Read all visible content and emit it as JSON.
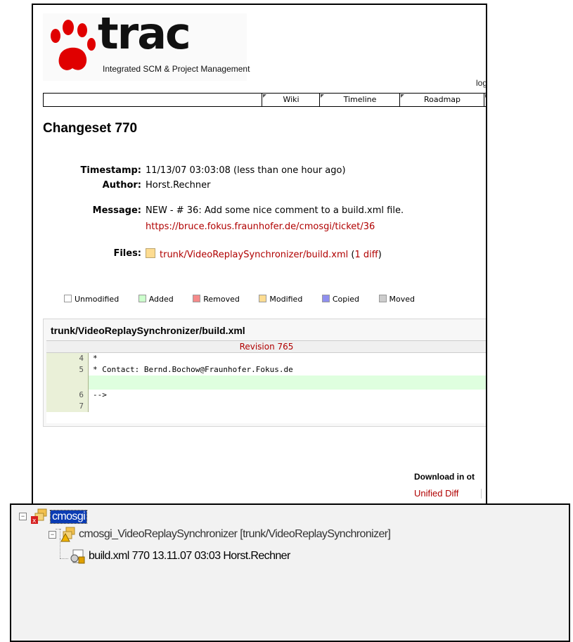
{
  "trac": {
    "logo_word": "trac",
    "logo_tagline": "Integrated SCM & Project Management",
    "login_fragment": "log",
    "nav": [
      "Wiki",
      "Timeline",
      "Roadmap"
    ],
    "page_title": "Changeset 770",
    "props": {
      "timestamp_label": "Timestamp:",
      "timestamp_value": "11/13/07 03:03:08 (less than one hour ago)",
      "author_label": "Author:",
      "author_value": "Horst.Rechner",
      "message_label": "Message:",
      "message_value": "NEW - # 36: Add some nice comment to a build.xml file.",
      "message_link": "https://bruce.fokus.fraunhofer.de/cmosgi/ticket/36",
      "files_label": "Files:",
      "file_path": "trunk/VideoReplaySynchronizer/build.xml",
      "diff_open": "(",
      "diff_link": "1 diff",
      "diff_close": ")"
    },
    "legend": [
      {
        "label": "Unmodified",
        "color": "#ffffff"
      },
      {
        "label": "Added",
        "color": "#ccffcc"
      },
      {
        "label": "Removed",
        "color": "#f58a8a"
      },
      {
        "label": "Modified",
        "color": "#fddc91"
      },
      {
        "label": "Copied",
        "color": "#8f8fef"
      },
      {
        "label": "Moved",
        "color": "#cccccc"
      }
    ],
    "diff": {
      "title": "trunk/VideoReplaySynchronizer/build.xml",
      "revision": "Revision 765",
      "rows": [
        {
          "num": "4",
          "code": "*"
        },
        {
          "num": "5",
          "code": "* Contact: Bernd.Bochow@Fraunhofer.Fokus.de"
        },
        {
          "num": "",
          "code": ""
        },
        {
          "num": "6",
          "code": "-->"
        },
        {
          "num": "7",
          "code": ""
        }
      ]
    },
    "download_label": "Download in ot",
    "download_link": "Unified Diff"
  },
  "tree": {
    "root_label": "cmosgi",
    "project_label": "cmosgi_VideoReplaySynchronizer [trunk/VideoReplaySynchronizer]",
    "file_label": "build.xml 770  13.11.07 03:03  Horst.Rechner",
    "expander_glyph": "−"
  },
  "colors": {
    "link": "#b00000",
    "selection": "#0a3bb3",
    "added_row": "#dfffdf"
  }
}
